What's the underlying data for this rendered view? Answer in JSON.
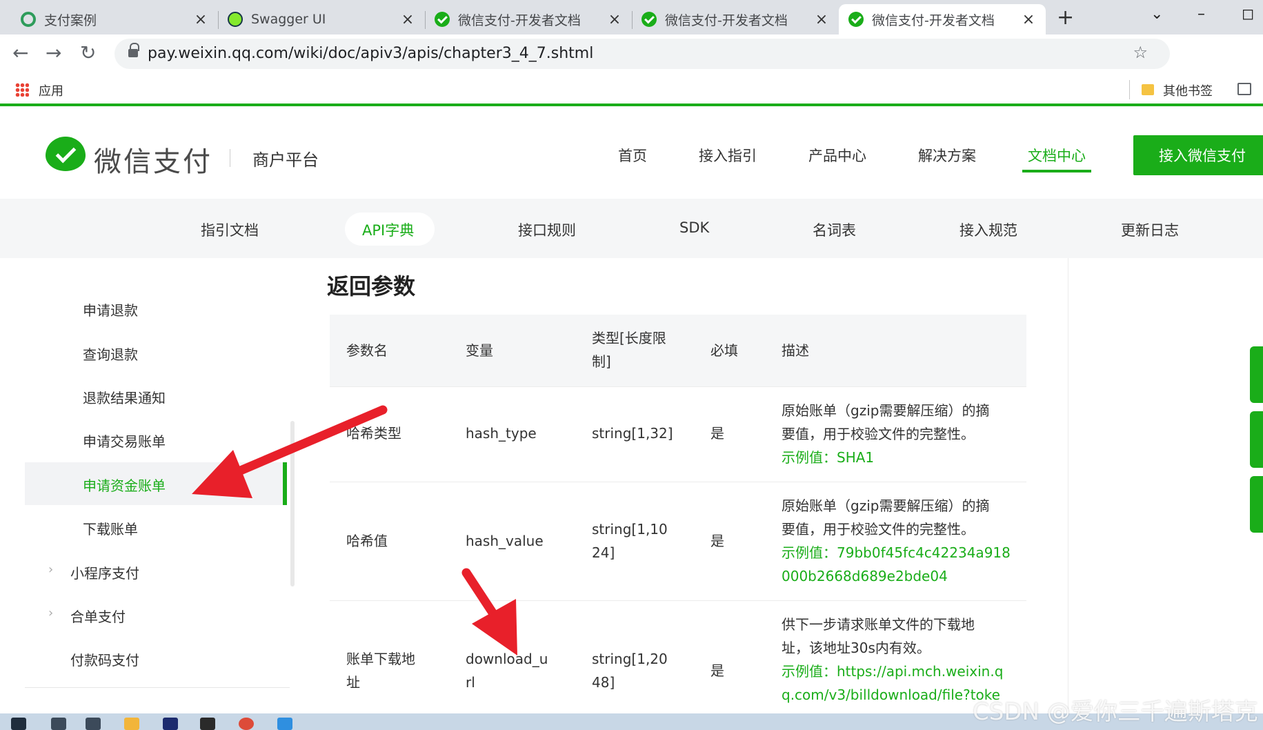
{
  "browser": {
    "tabs": [
      {
        "title": "支付案例",
        "icon": "g-circle-icon"
      },
      {
        "title": "Swagger UI",
        "icon": "swagger-icon"
      },
      {
        "title": "微信支付-开发者文档",
        "icon": "wechat-pay-icon"
      },
      {
        "title": "微信支付-开发者文档",
        "icon": "wechat-pay-icon"
      },
      {
        "title": "微信支付-开发者文档",
        "icon": "wechat-pay-icon"
      }
    ],
    "close_glyph": "×",
    "new_tab_glyph": "+",
    "url": "pay.weixin.qq.com/wiki/doc/apiv3/apis/chapter3_4_7.shtml",
    "bookmarks": {
      "apps_label": "应用",
      "other_label": "其他书签"
    }
  },
  "header": {
    "logo_text": "微信支付",
    "merchant": "商户平台",
    "nav": [
      "首页",
      "接入指引",
      "产品中心",
      "解决方案",
      "文档中心"
    ],
    "cta": "接入微信支付",
    "accent": "#1aad19"
  },
  "subnav": [
    "指引文档",
    "API字典",
    "接口规则",
    "SDK",
    "名词表",
    "接入规范",
    "更新日志"
  ],
  "sidebar": {
    "items": [
      {
        "label": "申请退款"
      },
      {
        "label": "查询退款"
      },
      {
        "label": "退款结果通知"
      },
      {
        "label": "申请交易账单"
      },
      {
        "label": "申请资金账单"
      },
      {
        "label": "下载账单"
      }
    ],
    "groups": [
      {
        "label": "小程序支付"
      },
      {
        "label": "合单支付"
      },
      {
        "label": "付款码支付"
      }
    ]
  },
  "content": {
    "section_title": "返回参数",
    "columns": [
      "参数名",
      "变量",
      "类型[长度限制]",
      "必填",
      "描述"
    ],
    "rows": [
      {
        "name": "哈希类型",
        "var": "hash_type",
        "type": "string[1,32]",
        "required": "是",
        "desc1": "原始账单（gzip需要解压缩）的摘",
        "desc2": "要值，用于校验文件的完整性。",
        "ex1": "示例值：SHA1"
      },
      {
        "name": "哈希值",
        "var": "hash_value",
        "type1": "string[1,10",
        "type2": "24]",
        "required": "是",
        "desc1": "原始账单（gzip需要解压缩）的摘",
        "desc2": "要值，用于校验文件的完整性。",
        "ex1": "示例值：79bb0f45fc4c42234a918",
        "ex2": "000b2668d689e2bde04"
      },
      {
        "name1": "账单下载地",
        "name2": "址",
        "var1": "download_u",
        "var2": "rl",
        "type1": "string[1,20",
        "type2": "48]",
        "required": "是",
        "desc1": "供下一步请求账单文件的下载地",
        "desc2": "址，该地址30s内有效。",
        "ex1": "示例值：https://api.mch.weixin.q",
        "ex2": "q.com/v3/billdownload/file?toke"
      }
    ]
  },
  "watermark": "CSDN @爱你三千遍斯塔克",
  "annotation_color": "#e8202a"
}
